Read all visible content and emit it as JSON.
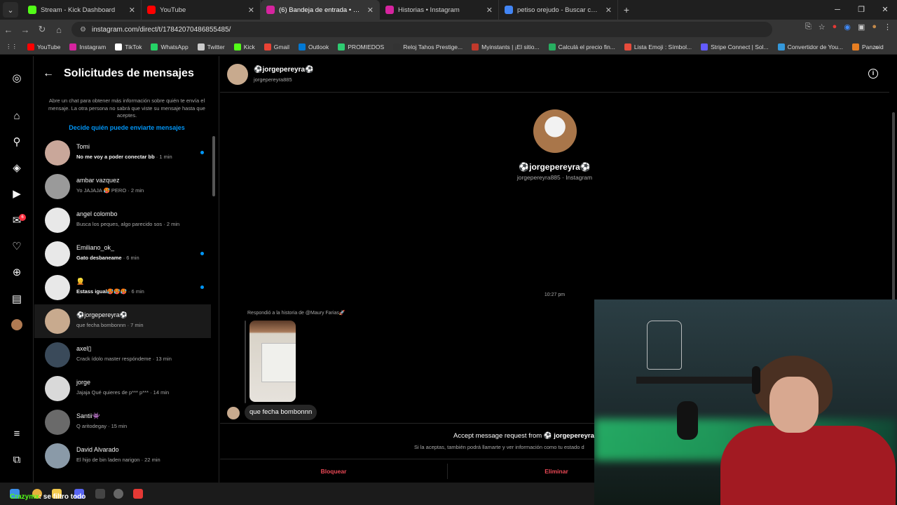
{
  "browser": {
    "tabs": [
      {
        "title": "Stream - Kick Dashboard",
        "color": "#53fc18",
        "active": false
      },
      {
        "title": "YouTube",
        "color": "#ff0000",
        "active": false
      },
      {
        "title": "(6) Bandeja de entrada • Chats",
        "color": "#d6249f",
        "active": true
      },
      {
        "title": "Historias • Instagram",
        "color": "#d6249f",
        "active": false
      },
      {
        "title": "petiso orejudo - Buscar con Go",
        "color": "#4285f4",
        "active": false
      }
    ],
    "url": "instagram.com/direct/t/17842070486855485/",
    "bookmarks": [
      {
        "label": "YouTube",
        "color": "#ff0000"
      },
      {
        "label": "Instagram",
        "color": "#d6249f"
      },
      {
        "label": "TikTok",
        "color": "#ffffff"
      },
      {
        "label": "WhatsApp",
        "color": "#25d366"
      },
      {
        "label": "Twitter",
        "color": "#cccccc"
      },
      {
        "label": "Kick",
        "color": "#53fc18"
      },
      {
        "label": "Gmail",
        "color": "#ea4335"
      },
      {
        "label": "Outlook",
        "color": "#0078d4"
      },
      {
        "label": "PROMIEDOS",
        "color": "#2ecc71"
      },
      {
        "label": "Reloj Tahos Prestige...",
        "color": "#333333"
      },
      {
        "label": "Myinstants | ¡El sitio...",
        "color": "#c0392b"
      },
      {
        "label": "Calculá el precio fin...",
        "color": "#27ae60"
      },
      {
        "label": "Lista Emoji : Símbol...",
        "color": "#e74c3c"
      },
      {
        "label": "Stripe Connect | Sol...",
        "color": "#635bff"
      },
      {
        "label": "Convertidor de You...",
        "color": "#3498db"
      },
      {
        "label": "Panzoid",
        "color": "#e67e22"
      }
    ]
  },
  "nav": {
    "notification_count": "6"
  },
  "requests": {
    "title": "Solicitudes de mensajes",
    "info": "Abre un chat para obtener más información sobre quién te envía el mensaje. La otra persona no sabrá que viste su mensaje hasta que aceptes.",
    "link": "Decide quién puede enviarte mensajes",
    "rows": [
      {
        "name": "Tomi",
        "preview": "No me voy a poder conectar bb",
        "time": " · 1 min",
        "unread": true,
        "avatar": "#c9a79a"
      },
      {
        "name": "ambar vazquez",
        "preview": "Yo JAJAJA 🥵 PERO",
        "time": " · 2 min",
        "unread": false,
        "avatar": "#9a9a9a"
      },
      {
        "name": "angel colombo",
        "preview": "Busca los peques, algo parecido sos",
        "time": " · 2 min",
        "unread": false,
        "avatar": "#e8e8e8"
      },
      {
        "name": "Emiliano_ok_",
        "preview": "Gato desbaneame",
        "time": " · 6 min",
        "unread": true,
        "avatar": "#e8e8e8"
      },
      {
        "name": "👱",
        "preview": "Estass igual🥵🥵🥵",
        "time": " · 6 min",
        "unread": true,
        "avatar": "#e8e8e8"
      },
      {
        "name": "⚽jorgepereyra⚽",
        "preview": "que fecha bombonnn",
        "time": " · 7 min",
        "unread": false,
        "avatar": "#c8aa8e"
      },
      {
        "name": "axel▯",
        "preview": "Crack ídolo master respóndeme",
        "time": " · 13 min",
        "unread": false,
        "avatar": "#3a4a5a"
      },
      {
        "name": "jorge",
        "preview": "Jajaja Qué quieres de p*** p***",
        "time": " · 14 min",
        "unread": false,
        "avatar": "#d9d9d9"
      },
      {
        "name": "Santii👾",
        "preview": "Q aritodegay",
        "time": " · 15 min",
        "unread": false,
        "avatar": "#6a6a6a"
      },
      {
        "name": "David Alvarado",
        "preview": "El hijo de bin laden narigon",
        "time": " · 22 min",
        "unread": false,
        "avatar": "#8a9aa8"
      }
    ]
  },
  "chat": {
    "header_name": "⚽jorgepereyra⚽",
    "header_username": "jorgepereyra885",
    "profile_name": "⚽jorgepereyra⚽",
    "profile_sub": "jorgepereyra885 · Instagram",
    "timestamp": "10:27 pm",
    "story_reply": "Respondió a la historia de @Maury Farias🚀",
    "message": "que fecha bombonnn",
    "accept_prefix": "Accept message request from ",
    "accept_name": "⚽ jorgepereyra ⚽",
    "accept_sub": "Si la aceptas, también podrá llamarte y ver información como tu estado d",
    "block_label": "Bloquear",
    "delete_label": "Eliminar"
  },
  "stream_chat": {
    "user": "Crazymx",
    "message": ": se filtro todo"
  }
}
